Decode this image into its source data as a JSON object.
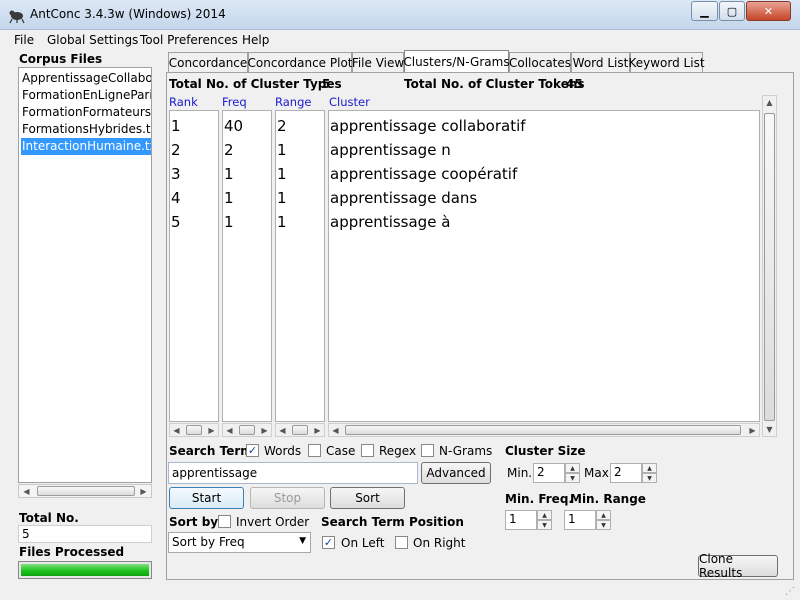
{
  "window": {
    "title": "AntConc 3.4.3w (Windows) 2014"
  },
  "menu": [
    "File",
    "Global Settings",
    "Tool Preferences",
    "Help"
  ],
  "sidebar": {
    "header": "Corpus Files",
    "files": [
      "ApprentissageCollabo",
      "FormationEnLigneParit",
      "FormationFormateurs.t",
      "FormationsHybrides.tx",
      "InteractionHumaine.txt"
    ],
    "selected_index": 4,
    "total_label": "Total No.",
    "total_value": "5",
    "processed_label": "Files Processed",
    "progress": 1.0
  },
  "tabs": [
    "Concordance",
    "Concordance Plot",
    "File View",
    "Clusters/N-Grams",
    "Collocates",
    "Word List",
    "Keyword List"
  ],
  "active_tab_index": 3,
  "summary": {
    "types_label": "Total No. of Cluster Types",
    "types_value": "5",
    "tokens_label": "Total No. of Cluster Tokens",
    "tokens_value": "45"
  },
  "table": {
    "headers": {
      "rank": "Rank",
      "freq": "Freq",
      "range": "Range",
      "cluster": "Cluster"
    },
    "rows": [
      {
        "rank": "1",
        "freq": "40",
        "range": "2",
        "cluster": "apprentissage collaboratif"
      },
      {
        "rank": "2",
        "freq": "2",
        "range": "1",
        "cluster": "apprentissage n"
      },
      {
        "rank": "3",
        "freq": "1",
        "range": "1",
        "cluster": "apprentissage coopératif"
      },
      {
        "rank": "4",
        "freq": "1",
        "range": "1",
        "cluster": "apprentissage dans"
      },
      {
        "rank": "5",
        "freq": "1",
        "range": "1",
        "cluster": "apprentissage à"
      }
    ]
  },
  "search": {
    "label": "Search Term",
    "words_label": "Words",
    "words_checked": true,
    "case_label": "Case",
    "case_checked": false,
    "regex_label": "Regex",
    "regex_checked": false,
    "ngrams_label": "N-Grams",
    "ngrams_checked": false,
    "term": "apprentissage",
    "advanced_label": "Advanced",
    "start_label": "Start",
    "stop_label": "Stop",
    "sort_btn_label": "Sort"
  },
  "sort": {
    "label": "Sort by",
    "invert_label": "Invert Order",
    "invert_checked": false,
    "selected": "Sort by Freq"
  },
  "position": {
    "label": "Search Term Position",
    "left_label": "On Left",
    "left_checked": true,
    "right_label": "On Right",
    "right_checked": false
  },
  "cluster_size": {
    "label": "Cluster Size",
    "min_label": "Min.",
    "min_value": "2",
    "max_label": "Max.",
    "max_value": "2"
  },
  "min_freq": {
    "label": "Min. Freq.",
    "value": "1"
  },
  "min_range": {
    "label": "Min. Range",
    "value": "1"
  },
  "clone_label": "Clone Results",
  "checkmark": "✓",
  "colors": {
    "link_blue": "#1a1ad0",
    "selection": "#3399ff",
    "progress": "#19c019"
  }
}
